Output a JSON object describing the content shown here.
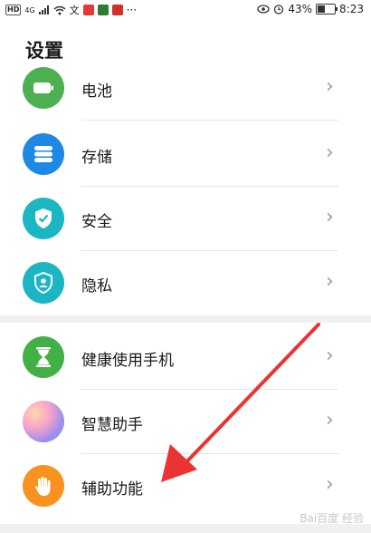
{
  "status_bar": {
    "network_label": "HD",
    "signal_label": "4G",
    "battery_percent": "43%",
    "battery_level": 0.43,
    "time": "8:23",
    "icons": [
      "signal-icon",
      "wifi-icon",
      "message-icon",
      "app-notification-icon",
      "eye-icon",
      "alarm-icon",
      "battery-icon"
    ]
  },
  "page": {
    "title": "设置"
  },
  "settings_top": [
    {
      "label": "电池",
      "icon": "battery-icon",
      "color": "#4caf50"
    },
    {
      "label": "存储",
      "icon": "storage-icon",
      "color": "#1e88e5"
    },
    {
      "label": "安全",
      "icon": "shield-check-icon",
      "color": "#1cb6c2"
    },
    {
      "label": "隐私",
      "icon": "privacy-shield-icon",
      "color": "#1cb6c2"
    }
  ],
  "settings_bottom": [
    {
      "label": "健康使用手机",
      "icon": "hourglass-icon",
      "color": "#43b047"
    },
    {
      "label": "智慧助手",
      "icon": "smart-assistant-icon",
      "color": "#b07de0"
    },
    {
      "label": "辅助功能",
      "icon": "hand-icon",
      "color": "#f7931e"
    }
  ],
  "annotation": {
    "arrow_color": "#ea3333"
  },
  "watermark": {
    "text": "Bai百度 经验"
  }
}
